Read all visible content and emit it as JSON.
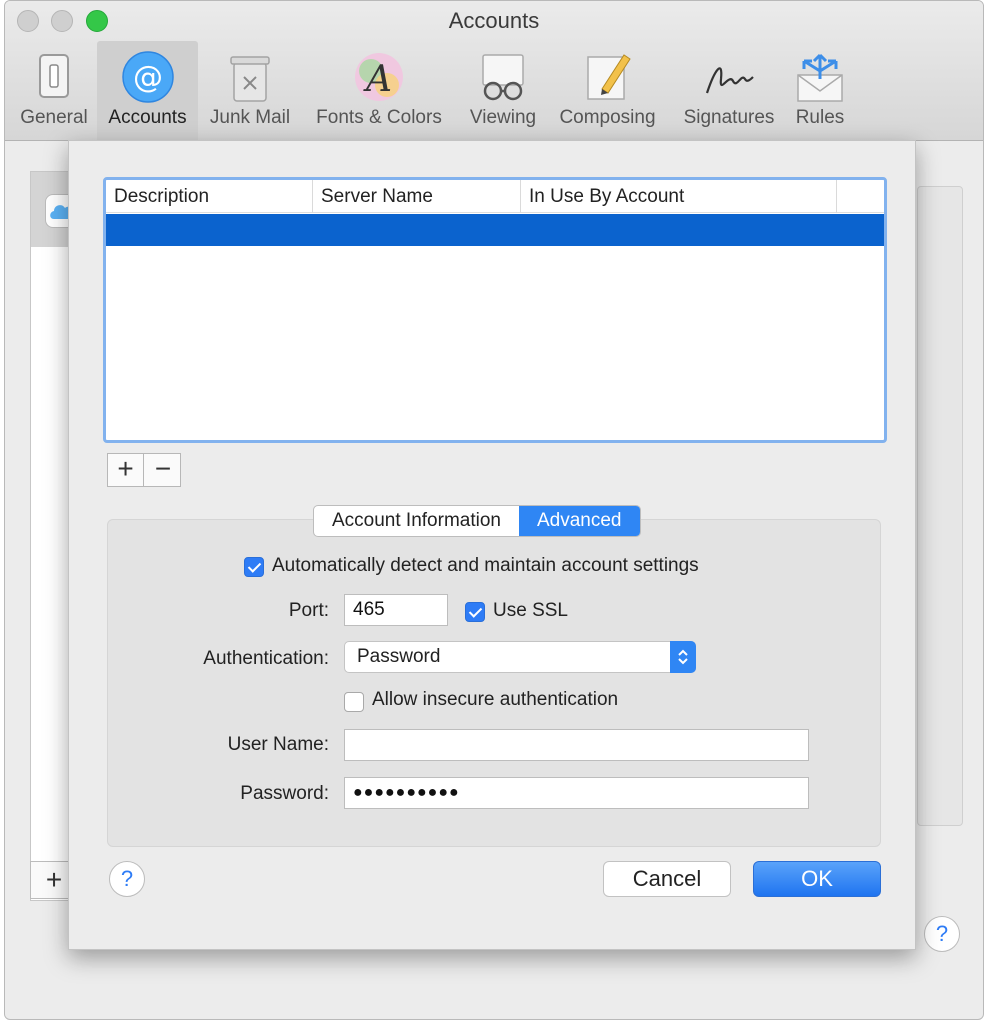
{
  "window": {
    "title": "Accounts"
  },
  "toolbar": {
    "items": [
      {
        "label": "General",
        "icon": "switch-icon"
      },
      {
        "label": "Accounts",
        "icon": "at-sign-icon"
      },
      {
        "label": "Junk Mail",
        "icon": "trash-bin-icon"
      },
      {
        "label": "Fonts & Colors",
        "icon": "font-palette-icon"
      },
      {
        "label": "Viewing",
        "icon": "glasses-icon"
      },
      {
        "label": "Composing",
        "icon": "pencil-paper-icon"
      },
      {
        "label": "Signatures",
        "icon": "signature-icon"
      },
      {
        "label": "Rules",
        "icon": "envelope-arrows-icon"
      }
    ],
    "active": "Accounts"
  },
  "background": {
    "add_label": "+",
    "help_label": "?"
  },
  "sheet": {
    "table": {
      "columns": [
        "Description",
        "Server Name",
        "In Use By Account"
      ]
    },
    "add_label": "+",
    "remove_label": "−",
    "tabs": [
      {
        "label": "Account Information",
        "selected": false
      },
      {
        "label": "Advanced",
        "selected": true
      }
    ],
    "auto_detect": {
      "label": "Automatically detect and maintain account settings",
      "checked": true
    },
    "port": {
      "label": "Port:",
      "value": "465"
    },
    "use_ssl": {
      "label": "Use SSL",
      "checked": true
    },
    "authentication": {
      "label": "Authentication:",
      "value": "Password"
    },
    "allow_insecure": {
      "label": "Allow insecure authentication",
      "checked": false
    },
    "user_name": {
      "label": "User Name:",
      "value": ""
    },
    "password": {
      "label": "Password:",
      "value": "●●●●●●●●●●"
    },
    "help_label": "?",
    "cancel_label": "Cancel",
    "ok_label": "OK"
  },
  "colors": {
    "accent": "#2f86f4",
    "selection": "#0b63ce",
    "zoom_button": "#34c748"
  }
}
